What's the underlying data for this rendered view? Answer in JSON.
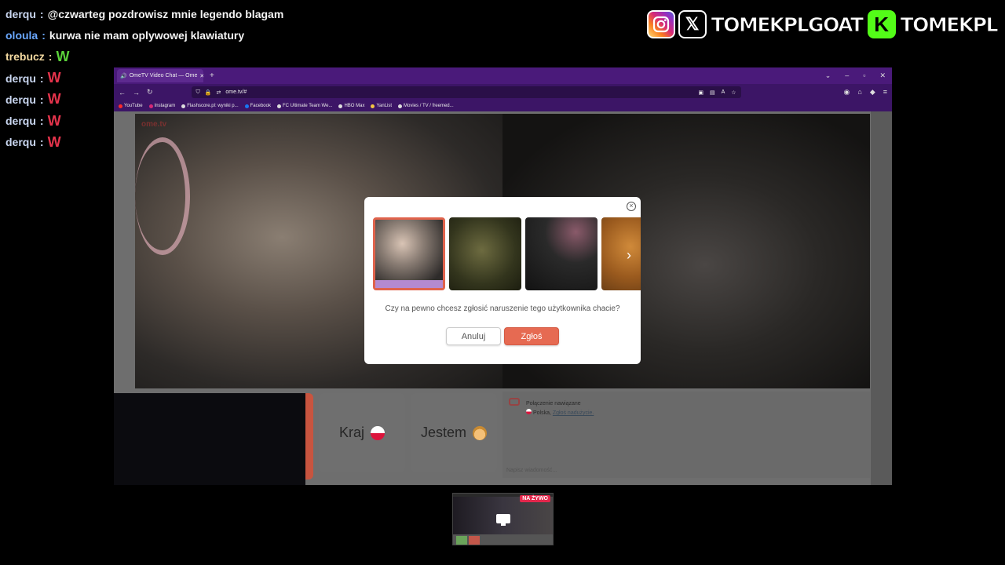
{
  "chat": [
    {
      "user": "derqu",
      "sep": ":",
      "message": "@czwarteg pozdrowisz mnie legendo blagam",
      "user_color": "#c9d6f0",
      "msg_color": "#f4f4f4",
      "kind": "text"
    },
    {
      "user": "oloula",
      "sep": ":",
      "message": "kurwa nie mam oplywowej klawiatury",
      "user_color": "#6aa8ff",
      "msg_color": "#f4f4f4",
      "kind": "text"
    },
    {
      "user": "trebucz",
      "sep": ":",
      "message": "W",
      "user_color": "#f3d9a0",
      "msg_color": "#5bd23a",
      "kind": "w"
    },
    {
      "user": "derqu",
      "sep": ":",
      "message": "W",
      "user_color": "#c9d6f0",
      "msg_color": "#e4334b",
      "kind": "w"
    },
    {
      "user": "derqu",
      "sep": ":",
      "message": "W",
      "user_color": "#c9d6f0",
      "msg_color": "#e4334b",
      "kind": "w"
    },
    {
      "user": "derqu",
      "sep": ":",
      "message": "W",
      "user_color": "#c9d6f0",
      "msg_color": "#e4334b",
      "kind": "w"
    },
    {
      "user": "derqu",
      "sep": ":",
      "message": "W",
      "user_color": "#c9d6f0",
      "msg_color": "#e4334b",
      "kind": "w"
    }
  ],
  "socials": {
    "instagram_icon": "instagram-icon",
    "x_icon_glyph": "𝕏",
    "x_name": "TOMEKPLGOAT",
    "kick_icon_glyph": "K",
    "kick_name": "TOMEKPL"
  },
  "browser": {
    "tab_title": "OmeTV Video Chat — Ome",
    "tab_plus": "+",
    "win_min": "–",
    "win_max": "▫",
    "win_close": "✕",
    "url": "ome.tv/#",
    "nav_back": "←",
    "nav_forward": "→",
    "nav_reload": "↻",
    "bookmarks": [
      "YouTube",
      "Instagram",
      "Flashscore.pl: wyniki p...",
      "Facebook",
      "FC Ultimate Team We...",
      "HBO Max",
      "YanList",
      "Movies / TV / freemed..."
    ],
    "bookmark_colors": [
      "#ff2a2a",
      "#d62976",
      "#ddd",
      "#1877f2",
      "#ddd",
      "#ddd",
      "#f5c542",
      "#ddd"
    ]
  },
  "ometv": {
    "logo": "ome.tv",
    "card_country": "Kraj",
    "card_gender": "Jestem",
    "chat_status": "Połączenie nawiązane",
    "chat_country": "Polska",
    "chat_report_link": "Zgłoś nadużycie.",
    "chat_input_placeholder": "Napisz wiadomość..."
  },
  "modal": {
    "close_glyph": "×",
    "question": "Czy na pewno chcesz zgłosić naruszenie tego użytkownika chacie?",
    "cancel_label": "Anuluj",
    "report_label": "Zgłoś",
    "next_glyph": "›"
  },
  "mini_preview": {
    "live_label": "NA ŻYWO"
  }
}
